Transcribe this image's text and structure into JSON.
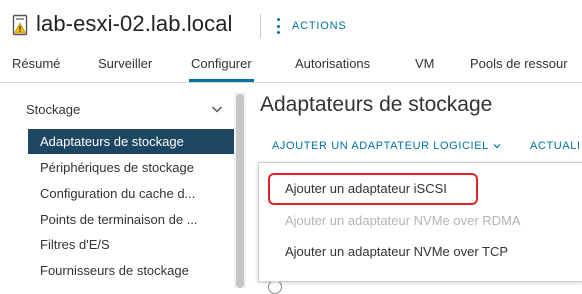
{
  "header": {
    "host_name": "lab-esxi-02.lab.local",
    "actions_label": "ACTIONS",
    "host_icon": "host-warning-icon"
  },
  "tabs": [
    {
      "label": "Résumé"
    },
    {
      "label": "Surveiller"
    },
    {
      "label": "Configurer",
      "active": true
    },
    {
      "label": "Autorisations"
    },
    {
      "label": "VM"
    },
    {
      "label": "Pools de ressour"
    }
  ],
  "sidebar": {
    "group_label": "Stockage",
    "items": [
      {
        "label": "Adaptateurs de stockage",
        "selected": true
      },
      {
        "label": "Périphériques de stockage"
      },
      {
        "label": "Configuration du cache d..."
      },
      {
        "label": "Points de terminaison de ..."
      },
      {
        "label": "Filtres d'E/S"
      },
      {
        "label": "Fournisseurs de stockage"
      }
    ]
  },
  "main": {
    "title": "Adaptateurs de stockage",
    "add_software_adapter_label": "AJOUTER UN ADAPTATEUR LOGICIEL",
    "refresh_label": "ACTUALI"
  },
  "dropdown": {
    "items": [
      {
        "label": "Ajouter un adaptateur iSCSI",
        "enabled": true,
        "highlighted": true
      },
      {
        "label": "Ajouter un adaptateur NVMe over RDMA",
        "enabled": false
      },
      {
        "label": "Ajouter un adaptateur NVMe over TCP",
        "enabled": true
      }
    ]
  },
  "colors": {
    "accent": "#0072a3",
    "nav_selected_bg": "#1d4663",
    "highlight": "#e0242a",
    "warning": "#f5b800"
  }
}
